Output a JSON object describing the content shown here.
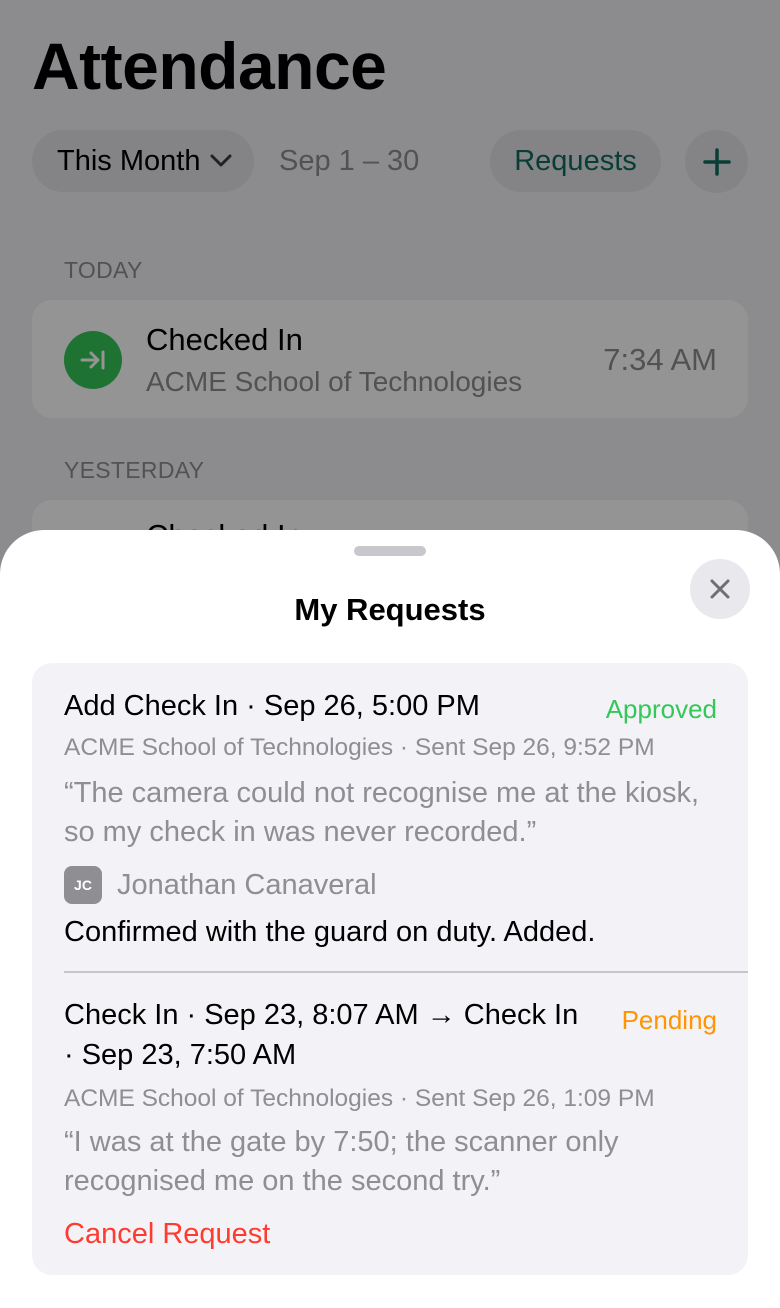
{
  "page": {
    "title": "Attendance",
    "period_label": "This Month",
    "date_range": "Sep 1 – 30",
    "requests_label": "Requests"
  },
  "sections": [
    {
      "label": "TODAY",
      "entry": {
        "title": "Checked In",
        "location": "ACME School of Technologies",
        "time": "7:34 AM",
        "icon": "check-in-arrow-icon",
        "color": "#34c759"
      }
    },
    {
      "label": "YESTERDAY",
      "entry": {
        "title": "Checked In"
      }
    }
  ],
  "sheet": {
    "title": "My Requests",
    "requests": [
      {
        "title": "Add Check In · Sep 26, 5:00 PM",
        "status": "Approved",
        "status_color": "#34c759",
        "meta": "ACME School of Technologies · Sent Sep 26, 9:52 PM",
        "note": "“The camera could not recognise me at the kiosk, so my check in was never recorded.”",
        "reviewer": {
          "initials": "JC",
          "name": "Jonathan Canaveral",
          "reply": "Confirmed with the guard on duty. Added."
        }
      },
      {
        "title": "Check In · Sep 23, 8:07 AM → Check In · Sep 23, 7:50 AM",
        "status": "Pending",
        "status_color": "#ff9500",
        "meta": "ACME School of Technologies · Sent Sep 26, 1:09 PM",
        "note": "“I was at the gate by 7:50; the scanner only recognised me on the second try.”",
        "action": "Cancel Request"
      }
    ]
  },
  "colors": {
    "accent": "#0f6b5e",
    "approved": "#34c759",
    "pending": "#ff9500",
    "destructive": "#ff3b30"
  }
}
